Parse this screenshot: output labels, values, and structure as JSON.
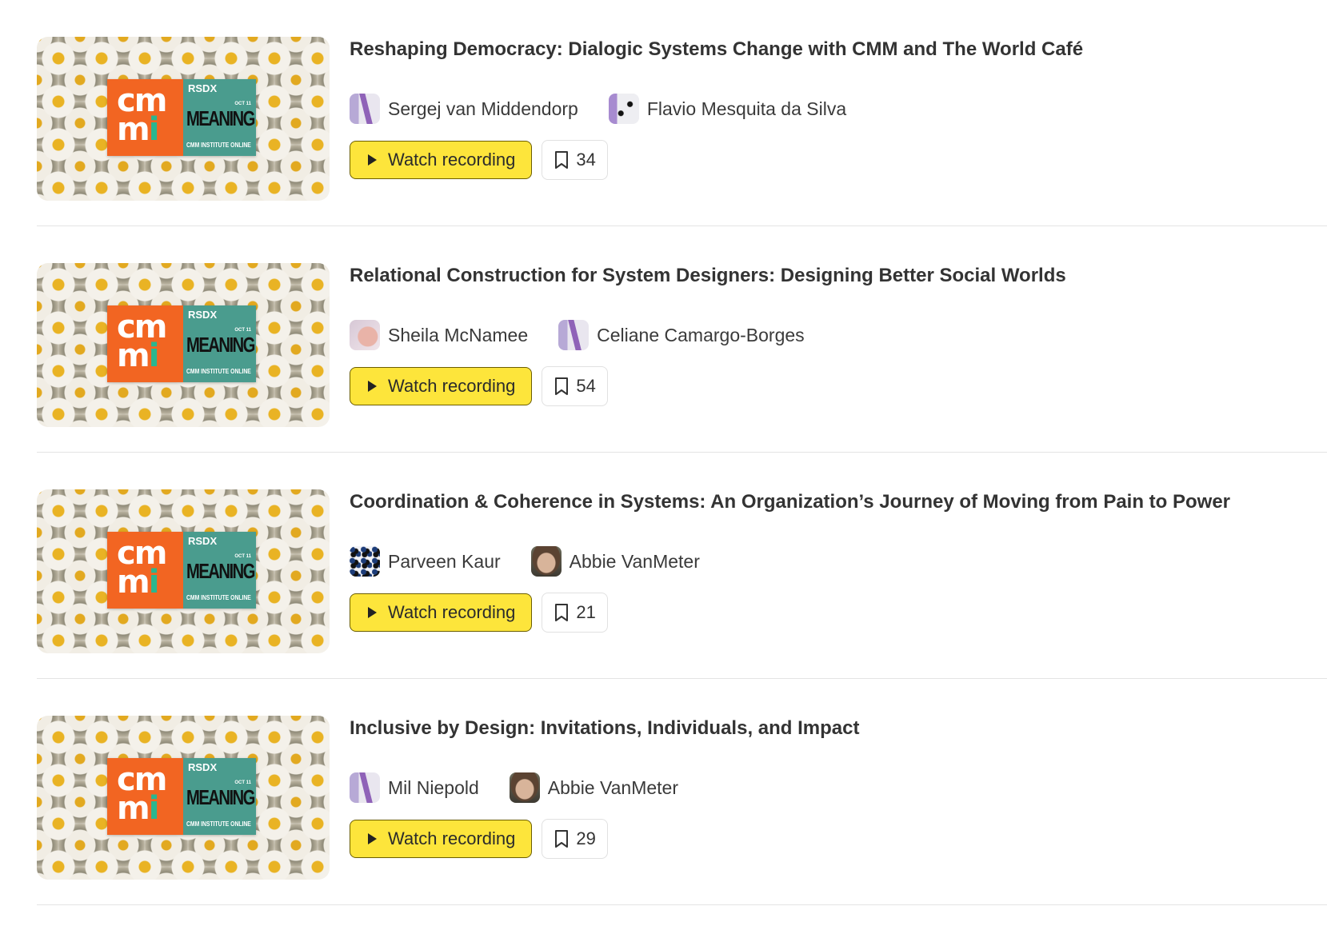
{
  "sessions": [
    {
      "title": "Reshaping Democracy: Dialogic Systems Change with CMM and The World Café",
      "speakers": [
        {
          "name": "Sergej van Middendorp",
          "avatar": "abstract-purple-avatar"
        },
        {
          "name": "Flavio Mesquita da Silva",
          "avatar": "abstract-dots-avatar"
        }
      ],
      "watch_label": "Watch recording",
      "bookmark_count": "34"
    },
    {
      "title": "Relational Construction for System Designers: Designing Better Social Worlds",
      "speakers": [
        {
          "name": "Sheila McNamee",
          "avatar": "abstract-pink-avatar"
        },
        {
          "name": "Celiane Camargo-Borges",
          "avatar": "abstract-purple-avatar"
        }
      ],
      "watch_label": "Watch recording",
      "bookmark_count": "54"
    },
    {
      "title": "Coordination & Coherence in Systems: An Organization’s Journey of Moving from Pain to Power",
      "speakers": [
        {
          "name": "Parveen Kaur",
          "avatar": "abstract-blue-dots-avatar"
        },
        {
          "name": "Abbie VanMeter",
          "avatar": "photo-avatar"
        }
      ],
      "watch_label": "Watch recording",
      "bookmark_count": "21"
    },
    {
      "title": "Inclusive by Design: Invitations, Individuals, and Impact",
      "speakers": [
        {
          "name": "Mil Niepold",
          "avatar": "abstract-purple-avatar"
        },
        {
          "name": "Abbie VanMeter",
          "avatar": "photo-avatar"
        }
      ],
      "watch_label": "Watch recording",
      "bookmark_count": "29"
    }
  ],
  "thumbnail": {
    "brand_left_top": "cm",
    "brand_left_bottom_m": "m",
    "brand_left_bottom_i": "i",
    "event": "RSDX",
    "date": "OCT 11",
    "headline": "MEANING",
    "org": "CMM INSTITUTE ONLINE"
  },
  "colors": {
    "watch_button": "#fde53b",
    "logo_orange": "#f26522",
    "logo_teal": "#4a9c8e"
  },
  "icons": {
    "play": "play-icon",
    "bookmark": "bookmark-icon"
  }
}
